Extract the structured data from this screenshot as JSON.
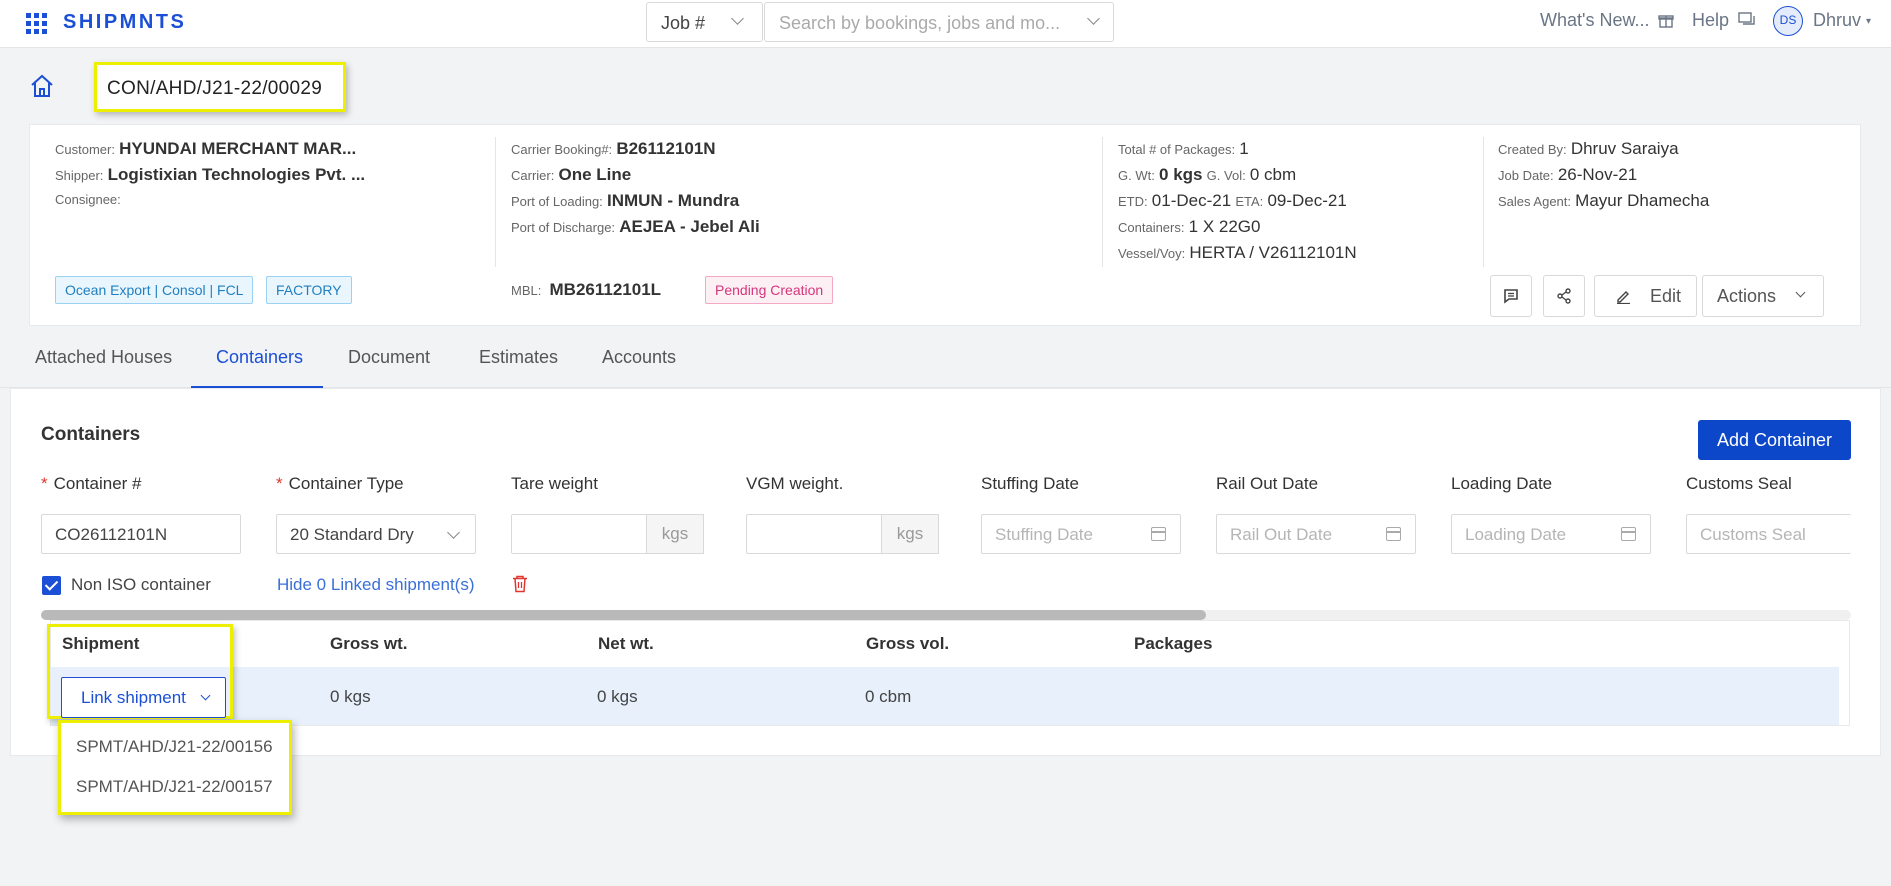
{
  "app": {
    "brand": "SHIPMNTS"
  },
  "topnav": {
    "job_select": "Job #",
    "search_placeholder": "Search by bookings, jobs and mo...",
    "whats_new": "What's New...",
    "help": "Help",
    "avatar_initials": "DS",
    "user_name": "Dhruv"
  },
  "job": {
    "number": "CON/AHD/J21-22/00029"
  },
  "info": {
    "customer_key": "Customer:",
    "customer": "HYUNDAI MERCHANT MAR...",
    "shipper_key": "Shipper:",
    "shipper": "Logistixian Technologies Pvt. ...",
    "consignee_key": "Consignee:",
    "carrier_booking_key": "Carrier Booking#:",
    "carrier_booking": "B26112101N",
    "carrier_key": "Carrier:",
    "carrier": "One Line",
    "pol_key": "Port of Loading:",
    "pol": "INMUN - Mundra",
    "pod_key": "Port of Discharge:",
    "pod": "AEJEA - Jebel Ali",
    "packages_key": "Total # of Packages:",
    "packages": "1",
    "gwt_key": "G. Wt:",
    "gwt": "0 kgs",
    "gvol_key": "G. Vol:",
    "gvol": "0 cbm",
    "etd_key": "ETD:",
    "etd": "01-Dec-21",
    "eta_key": "ETA:",
    "eta": "09-Dec-21",
    "containers_key": "Containers:",
    "containers": "1 X 22G0",
    "vessel_key": "Vessel/Voy:",
    "vessel": "HERTA / V26112101N",
    "created_by_key": "Created By:",
    "created_by": "Dhruv Saraiya",
    "job_date_key": "Job Date:",
    "job_date": "26-Nov-21",
    "sales_agent_key": "Sales Agent:",
    "sales_agent": "Mayur Dhamecha",
    "tag_service": "Ocean Export | Consol | FCL",
    "tag_factory": "FACTORY",
    "mbl_key": "MBL:",
    "mbl": "MB26112101L",
    "status": "Pending Creation",
    "edit_label": "Edit",
    "actions_label": "Actions"
  },
  "tabs": [
    "Attached Houses",
    "Containers",
    "Document",
    "Estimates",
    "Accounts"
  ],
  "containers": {
    "title": "Containers",
    "add_button": "Add Container",
    "labels": {
      "container_no": "Container #",
      "container_type": "Container Type",
      "tare_weight": "Tare weight",
      "vgm_weight": "VGM weight.",
      "stuffing_date": "Stuffing Date",
      "rail_out_date": "Rail Out Date",
      "loading_date": "Loading Date",
      "customs_seal": "Customs Seal"
    },
    "values": {
      "container_no": "CO26112101N",
      "container_type": "20 Standard Dry"
    },
    "placeholders": {
      "stuffing_date": "Stuffing Date",
      "rail_out_date": "Rail Out Date",
      "loading_date": "Loading Date",
      "customs_seal": "Customs Seal"
    },
    "unit": "kgs",
    "non_iso_label": "Non ISO container",
    "hide_linked": "Hide 0 Linked shipment(s)"
  },
  "shipment_table": {
    "headers": [
      "Shipment",
      "Gross wt.",
      "Net wt.",
      "Gross vol.",
      "Packages"
    ],
    "row": {
      "link_button": "Link shipment",
      "gross_wt": "0 kgs",
      "net_wt": "0 kgs",
      "gross_vol": "0 cbm",
      "packages": ""
    },
    "dropdown_options": [
      "SPMT/AHD/J21-22/00156",
      "SPMT/AHD/J21-22/00157"
    ]
  },
  "colors": {
    "accent": "#1a4fd6",
    "primary_button": "#0d47c9",
    "highlight": "#ecf000"
  }
}
